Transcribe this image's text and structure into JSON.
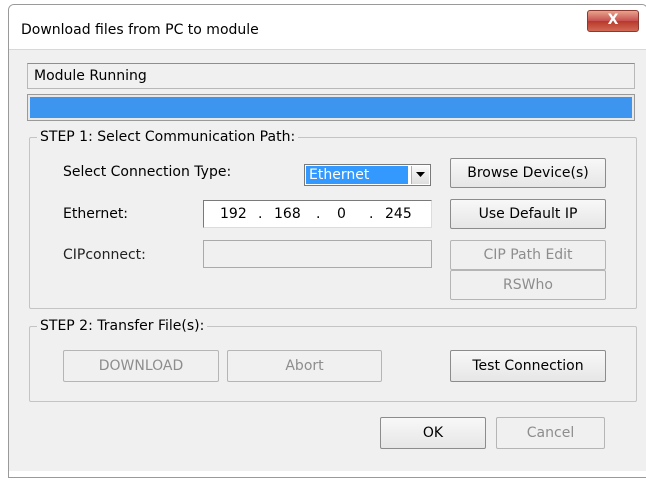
{
  "window": {
    "title": "Download files from PC to module",
    "close_glyph": "X"
  },
  "status": {
    "text": "Module Running",
    "progress_fraction": 1.0
  },
  "step1": {
    "legend": "STEP 1: Select Communication Path:",
    "connection_type_label": "Select Connection Type:",
    "connection_type_value": "Ethernet",
    "ethernet_label": "Ethernet:",
    "ip": {
      "octet1": "192",
      "octet2": "168",
      "octet3": "0",
      "octet4": "245",
      "separator": "."
    },
    "cipconnect_label": "CIPconnect:",
    "cipconnect_value": "",
    "browse_button": "Browse Device(s)",
    "default_ip_button": "Use Default IP",
    "cip_path_button": "CIP Path Edit",
    "rswho_button": "RSWho"
  },
  "step2": {
    "legend": "STEP 2: Transfer File(s):",
    "download_button": "DOWNLOAD",
    "abort_button": "Abort",
    "test_button": "Test Connection"
  },
  "footer": {
    "ok_button": "OK",
    "cancel_button": "Cancel"
  },
  "colors": {
    "progress": "#3d95f0",
    "selection": "#3399ff",
    "close_button": "#c75050"
  },
  "icons": {
    "combo_arrow": "dropdown-arrow-icon"
  }
}
